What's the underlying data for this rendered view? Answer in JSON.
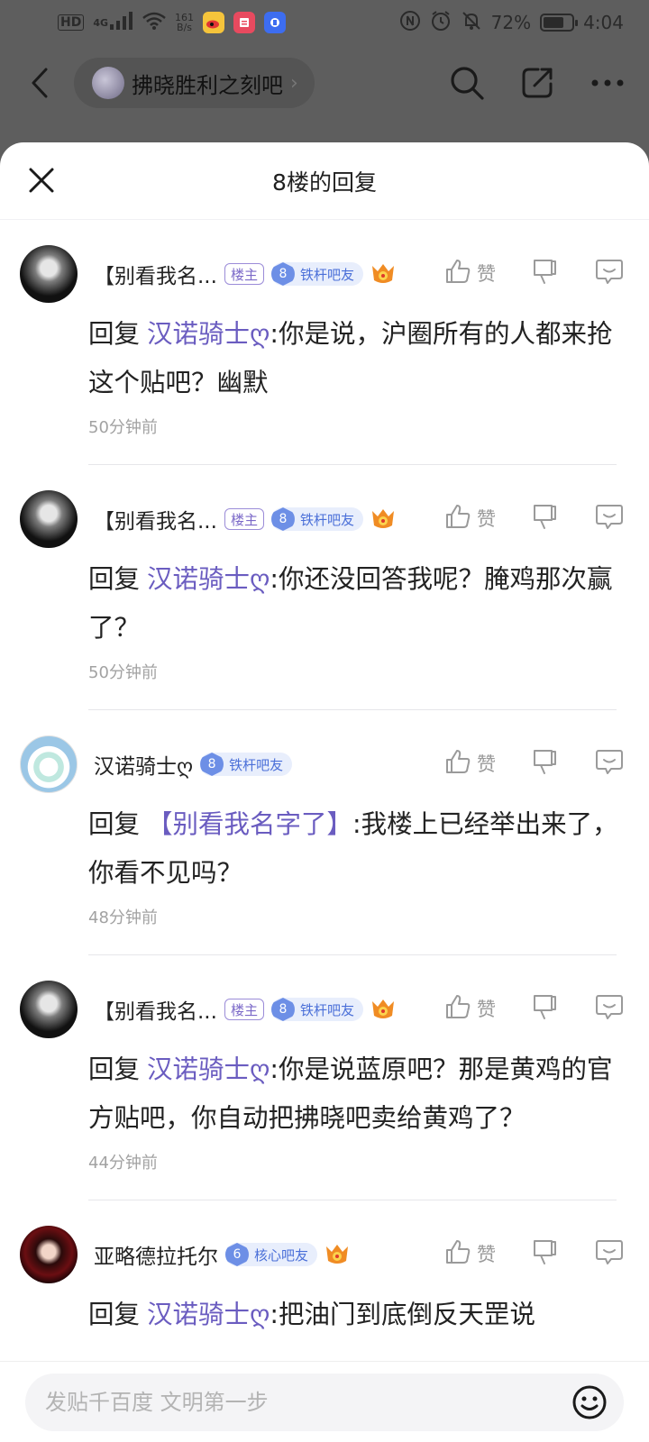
{
  "status_bar": {
    "hd": "HD",
    "signal": "4G",
    "net_speed_value": "161",
    "net_speed_unit": "B/s",
    "battery": "72%",
    "battery_level": 0.72,
    "time": "4:04"
  },
  "topnav": {
    "forum_name": "拂晓胜利之刻吧",
    "forum_chevron": "›"
  },
  "sheet": {
    "title": "8楼的回复",
    "close_icon": "close-icon"
  },
  "replies": [
    {
      "username": "【别看我名...",
      "is_owner": true,
      "owner_label": "楼主",
      "level": "8",
      "level_title": "铁杆吧友",
      "has_emblem": true,
      "prefix": "回复",
      "mention": "汉诺骑士ღ",
      "content": ":你是说，沪圈所有的人都来抢这个贴吧？幽默",
      "time": "50分钟前",
      "like_label": "赞"
    },
    {
      "username": "【别看我名...",
      "is_owner": true,
      "owner_label": "楼主",
      "level": "8",
      "level_title": "铁杆吧友",
      "has_emblem": true,
      "prefix": "回复",
      "mention": "汉诺骑士ღ",
      "content": ":你还没回答我呢？腌鸡那次赢了？",
      "time": "50分钟前",
      "like_label": "赞"
    },
    {
      "username": "汉诺骑士ღ",
      "is_owner": false,
      "owner_label": "",
      "level": "8",
      "level_title": "铁杆吧友",
      "has_emblem": false,
      "prefix": "回复",
      "mention": "【别看我名字了】",
      "content": ":我楼上已经举出来了，你看不见吗？",
      "time": "48分钟前",
      "like_label": "赞"
    },
    {
      "username": "【别看我名...",
      "is_owner": true,
      "owner_label": "楼主",
      "level": "8",
      "level_title": "铁杆吧友",
      "has_emblem": true,
      "prefix": "回复",
      "mention": "汉诺骑士ღ",
      "content": ":你是说蓝原吧？那是黄鸡的官方贴吧，你自动把拂晓吧卖给黄鸡了？",
      "time": "44分钟前",
      "like_label": "赞"
    },
    {
      "username": "亚略德拉托尔",
      "is_owner": false,
      "owner_label": "",
      "level": "6",
      "level_title": "核心吧友",
      "has_emblem": true,
      "prefix": "回复",
      "mention": "汉诺骑士ღ",
      "content": ":把油门到底倒反天罡说",
      "time": "",
      "like_label": "赞"
    }
  ],
  "bottom_bar": {
    "placeholder": "发贴千百度 文明第一步",
    "emoji_icon": "emoji-icon"
  },
  "colors": {
    "mention": "#6a5cc0",
    "level_badge": "#6d8fe6",
    "owner_badge": "#9b8cd8",
    "overlay": "#5e5e5e"
  }
}
